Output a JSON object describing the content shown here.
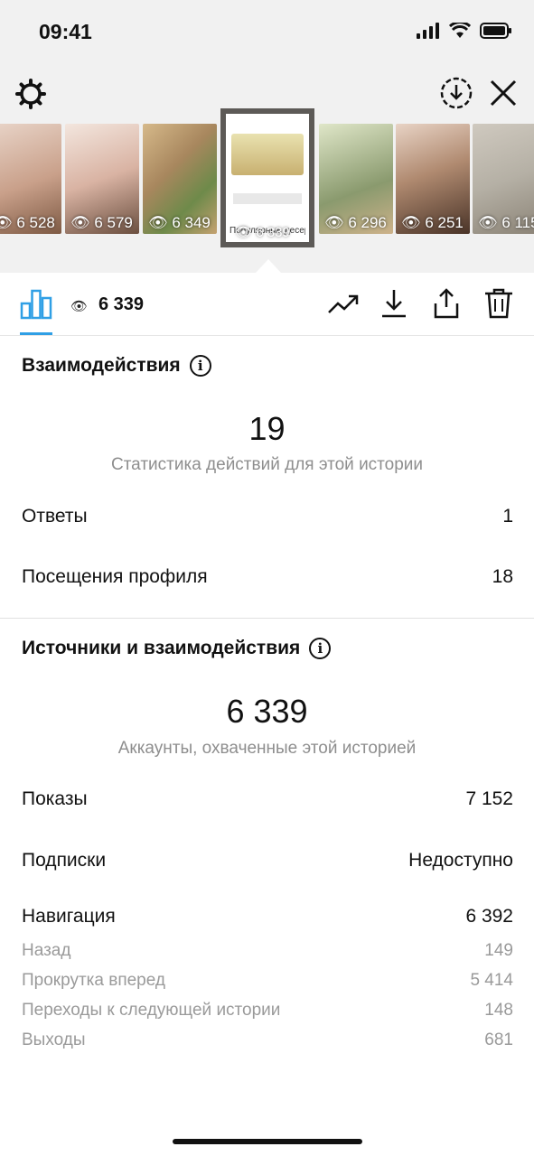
{
  "status_bar": {
    "time": "09:41"
  },
  "thumbnails": [
    {
      "views": "6 528",
      "bg": "#c9a08a"
    },
    {
      "views": "6 579",
      "bg": "#d9b3a3"
    },
    {
      "views": "6 349",
      "bg": "#a8875e"
    },
    {
      "views": "6 339",
      "bg": "#ffffff",
      "selected": true,
      "caption": "Популярные десерты"
    },
    {
      "views": "6 296",
      "bg": "#8a9a6e"
    },
    {
      "views": "6 251",
      "bg": "#7a5a45"
    },
    {
      "views": "6 115",
      "bg": "#b5b0a5"
    }
  ],
  "toolbar": {
    "views_count": "6 339"
  },
  "interactions": {
    "title": "Взаимодействия",
    "total": "19",
    "caption": "Статистика действий для этой истории",
    "rows": [
      {
        "label": "Ответы",
        "value": "1"
      },
      {
        "label": "Посещения профиля",
        "value": "18"
      }
    ]
  },
  "discovery": {
    "title": "Источники и взаимодействия",
    "total": "6 339",
    "caption": "Аккаунты, охваченные этой историей",
    "rows": [
      {
        "label": "Показы",
        "value": "7 152"
      },
      {
        "label": "Подписки",
        "value": "Недоступно"
      },
      {
        "label": "Навигация",
        "value": "6 392"
      }
    ],
    "navigation": [
      {
        "label": "Назад",
        "value": "149"
      },
      {
        "label": "Прокрутка вперед",
        "value": "5 414"
      },
      {
        "label": "Переходы к следующей истории",
        "value": "148"
      },
      {
        "label": "Выходы",
        "value": "681"
      }
    ]
  },
  "colors": {
    "accent": "#2f9fe5",
    "muted": "#8e8e8e"
  }
}
